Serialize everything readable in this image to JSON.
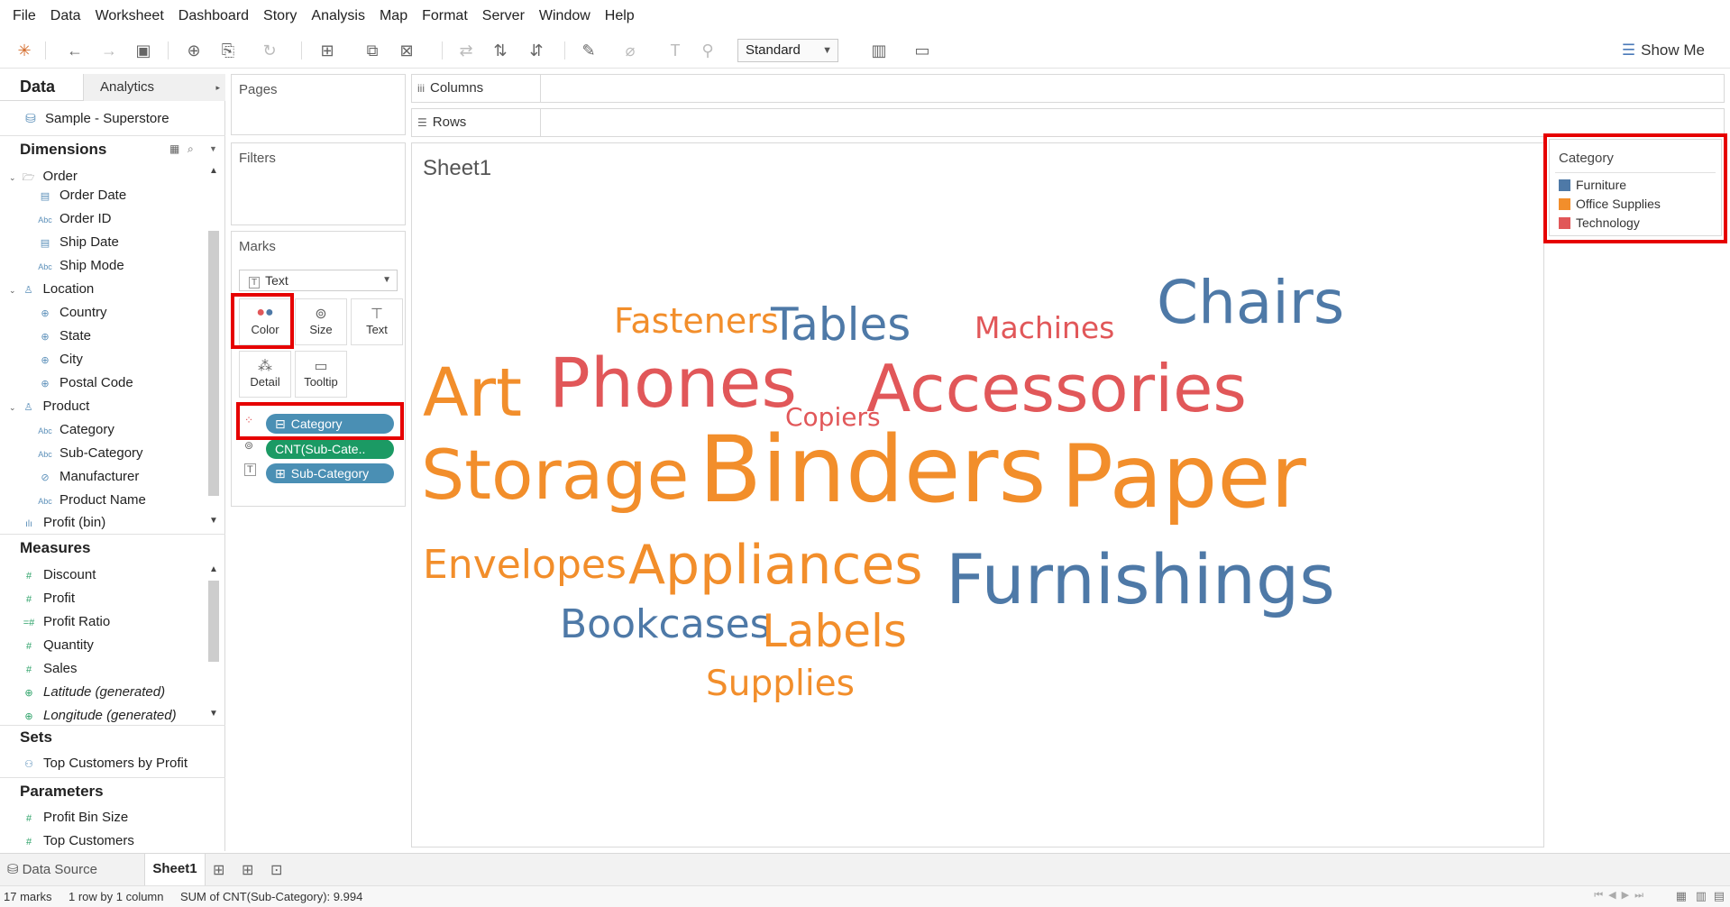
{
  "menu": [
    "File",
    "Data",
    "Worksheet",
    "Dashboard",
    "Story",
    "Analysis",
    "Map",
    "Format",
    "Server",
    "Window",
    "Help"
  ],
  "toolbar": {
    "fit_select": "Standard",
    "show_me": "Show Me"
  },
  "data_pane": {
    "tab_data": "Data",
    "tab_analytics": "Analytics",
    "datasource": "Sample - Superstore",
    "dimensions_title": "Dimensions",
    "groups": [
      {
        "name": "Order",
        "fields": [
          "Order Date",
          "Order ID",
          "Ship Date",
          "Ship Mode"
        ]
      },
      {
        "name": "Location",
        "fields": [
          "Country",
          "State",
          "City",
          "Postal Code"
        ]
      },
      {
        "name": "Product",
        "fields": [
          "Category",
          "Sub-Category",
          "Manufacturer",
          "Product Name"
        ]
      }
    ],
    "extra_dimension": "Profit (bin)",
    "measures_title": "Measures",
    "measures": [
      "Discount",
      "Profit",
      "Profit Ratio",
      "Quantity",
      "Sales",
      "Latitude (generated)",
      "Longitude (generated)"
    ],
    "sets_title": "Sets",
    "sets": [
      "Top Customers by Profit"
    ],
    "parameters_title": "Parameters",
    "parameters": [
      "Profit Bin Size",
      "Top Customers"
    ]
  },
  "shelves": {
    "pages": "Pages",
    "filters": "Filters",
    "marks": "Marks",
    "mark_type": "Text",
    "buttons": {
      "color": "Color",
      "size": "Size",
      "text": "Text",
      "detail": "Detail",
      "tooltip": "Tooltip"
    },
    "pills": [
      "Category",
      "CNT(Sub-Cate..",
      "Sub-Category"
    ],
    "columns": "Columns",
    "rows": "Rows"
  },
  "sheet": {
    "title": "Sheet1"
  },
  "chart_data": {
    "type": "word cloud (text marks)",
    "color_field": "Category",
    "size_field": "CNT(Sub-Category)",
    "text_field": "Sub-Category",
    "colors": {
      "Furniture": "#4e79a7",
      "Office Supplies": "#f28e2b",
      "Technology": "#e15759"
    },
    "words": [
      {
        "text": "Fasteners",
        "category": "Office Supplies"
      },
      {
        "text": "Tables",
        "category": "Furniture"
      },
      {
        "text": "Machines",
        "category": "Technology"
      },
      {
        "text": "Chairs",
        "category": "Furniture"
      },
      {
        "text": "Art",
        "category": "Office Supplies"
      },
      {
        "text": "Phones",
        "category": "Technology"
      },
      {
        "text": "Copiers",
        "category": "Technology"
      },
      {
        "text": "Accessories",
        "category": "Technology"
      },
      {
        "text": "Storage",
        "category": "Office Supplies"
      },
      {
        "text": "Binders",
        "category": "Office Supplies"
      },
      {
        "text": "Paper",
        "category": "Office Supplies"
      },
      {
        "text": "Envelopes",
        "category": "Office Supplies"
      },
      {
        "text": "Appliances",
        "category": "Office Supplies"
      },
      {
        "text": "Furnishings",
        "category": "Furniture"
      },
      {
        "text": "Bookcases",
        "category": "Furniture"
      },
      {
        "text": "Labels",
        "category": "Office Supplies"
      },
      {
        "text": "Supplies",
        "category": "Office Supplies"
      }
    ]
  },
  "legend": {
    "title": "Category",
    "items": [
      {
        "label": "Furniture",
        "color": "#4e79a7"
      },
      {
        "label": "Office Supplies",
        "color": "#f28e2b"
      },
      {
        "label": "Technology",
        "color": "#e15759"
      }
    ]
  },
  "bottom": {
    "data_source_tab": "Data Source",
    "sheet_tab": "Sheet1"
  },
  "status": {
    "marks": "17 marks",
    "rows_cols": "1 row by 1 column",
    "sum": "SUM of CNT(Sub-Category): 9.994"
  }
}
